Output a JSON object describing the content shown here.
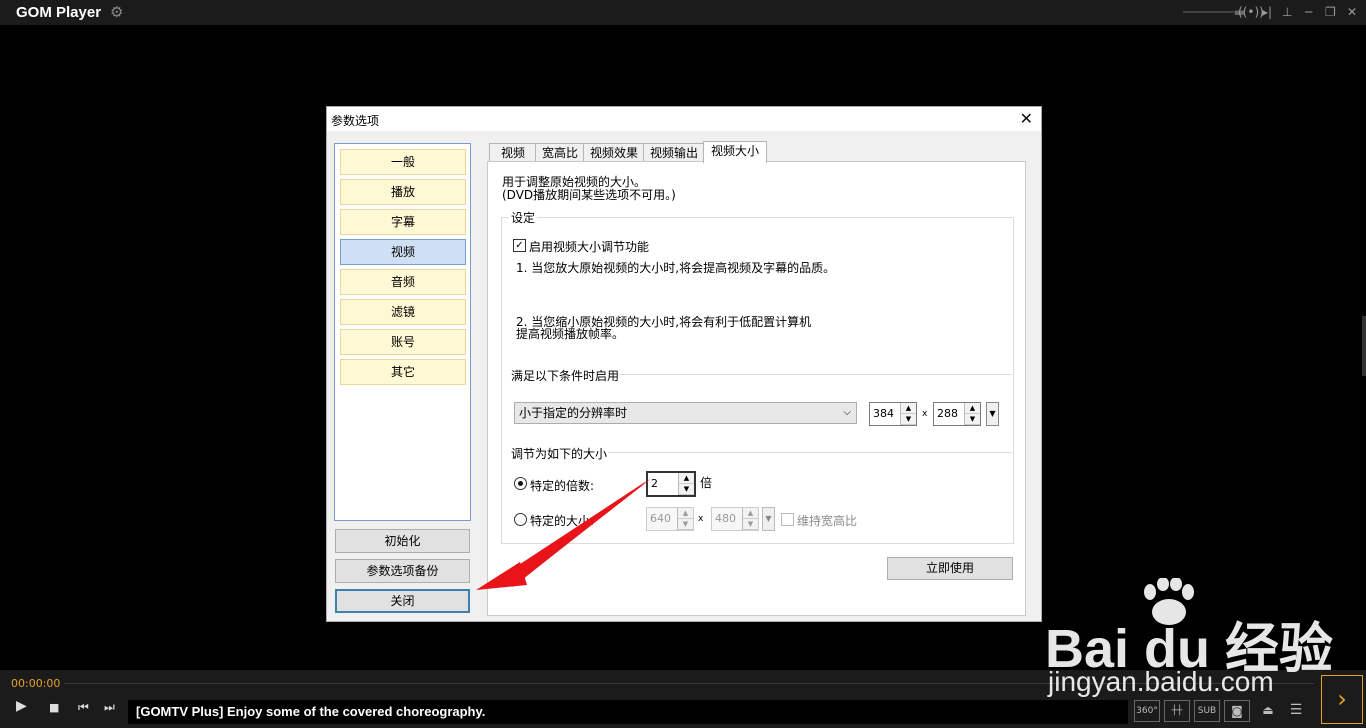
{
  "app": {
    "title": "GOM Player",
    "icons": {
      "settings": "gear-icon",
      "minimize": "minimize-icon",
      "restore": "restore-icon",
      "close": "close-icon"
    }
  },
  "dialog": {
    "title": "参数选项",
    "close_glyph": "✕",
    "nav": [
      "一般",
      "播放",
      "字幕",
      "视频",
      "音频",
      "滤镜",
      "账号",
      "其它"
    ],
    "selected_nav": "视频",
    "init_button": "初始化",
    "backup_button": "参数选项备份",
    "close_button": "关闭",
    "tabs": [
      "视频",
      "宽高比",
      "视频效果",
      "视频输出",
      "视频大小"
    ],
    "active_tab": "视频大小",
    "desc_line1": "用于调整原始视频的大小。",
    "desc_line2": "(DVD播放期间某些选项不可用。)",
    "settings_group": "设定",
    "enable_checkbox": "启用视频大小调节功能",
    "enable_checked": true,
    "note1": "1. 当您放大原始视频的大小时,将会提高视频及字幕的品质。",
    "note2a": "2. 当您缩小原始视频的大小时,将会有利于低配置计算机",
    "note2b": "提高视频播放帧率。",
    "condition_group": "满足以下条件时启用",
    "condition_select": "小于指定的分辨率时",
    "res_width": "384",
    "res_x": "x",
    "res_height": "288",
    "adjust_group": "调节为如下的大小",
    "radio_scale": "特定的倍数:",
    "scale_value": "2",
    "scale_unit": "倍",
    "radio_size": "特定的大小:",
    "size_width": "640",
    "size_x": "x",
    "size_height": "480",
    "keep_ratio": "维持宽高比",
    "apply_button": "立即使用"
  },
  "player": {
    "time": "00:00:00",
    "ticker": "[GOMTV Plus] Enjoy some of the covered choreography.",
    "controls": [
      "play-icon",
      "stop-icon",
      "prev-icon",
      "next-icon"
    ],
    "right_icons": [
      "360-icon",
      "equalizer-icon",
      "subtitle-icon",
      "camera-icon",
      "eject-icon",
      "menu-icon"
    ],
    "sub_label": "SUB",
    "vr_label": "360°"
  },
  "watermark": {
    "brand": "Bai du 经验",
    "url": "jingyan.baidu.com"
  }
}
